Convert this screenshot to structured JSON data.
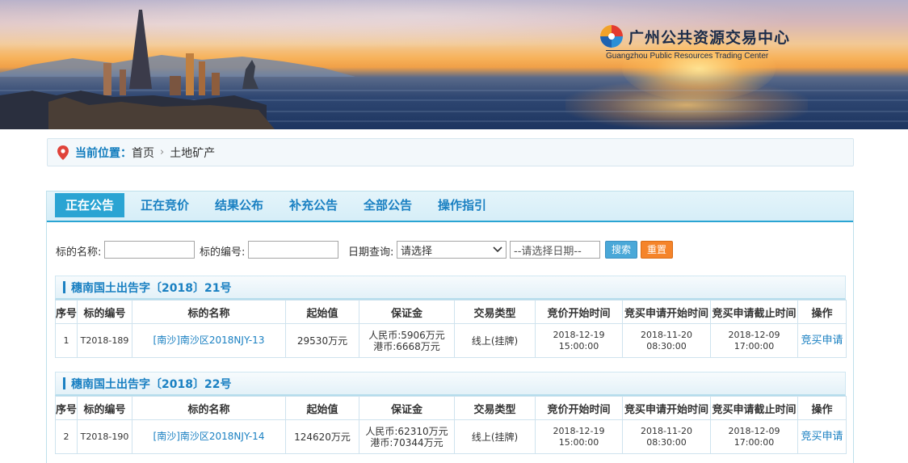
{
  "banner": {
    "logo_cn": "广州公共资源交易中心",
    "logo_en": "Guangzhou Public Resources Trading Center"
  },
  "breadcrumb": {
    "label": "当前位置：",
    "items": [
      "首页",
      "土地矿产"
    ],
    "separator": "›"
  },
  "tabs": [
    {
      "label": "正在公告",
      "active": true
    },
    {
      "label": "正在竞价",
      "active": false
    },
    {
      "label": "结果公布",
      "active": false
    },
    {
      "label": "补充公告",
      "active": false
    },
    {
      "label": "全部公告",
      "active": false
    },
    {
      "label": "操作指引",
      "active": false
    }
  ],
  "search": {
    "name_label": "标的名称:",
    "name_value": "",
    "code_label": "标的编号:",
    "code_value": "",
    "date_label": "日期查询:",
    "date_select": "请选择",
    "date_placeholder": "--请选择日期--",
    "search_btn": "搜索",
    "reset_btn": "重置"
  },
  "table_headers": [
    "序号",
    "标的编号",
    "标的名称",
    "起始值",
    "保证金",
    "交易类型",
    "竞价开始时间",
    "竞买申请开始时间",
    "竞买申请截止时间",
    "操作"
  ],
  "announcements": [
    {
      "title": "穗南国土出告字〔2018〕21号",
      "rows": [
        {
          "no": "1",
          "code": "T2018-189",
          "name": "[南沙]南沙区2018NJY-13",
          "start_value": "29530万元",
          "deposit_rmb": "人民币:5906万元",
          "deposit_hkd": "港币:6668万元",
          "type": "线上(挂牌)",
          "bid_start_date": "2018-12-19",
          "bid_start_time": "15:00:00",
          "apply_start_date": "2018-11-20",
          "apply_start_time": "08:30:00",
          "apply_end_date": "2018-12-09",
          "apply_end_time": "17:00:00",
          "action": "竞买申请"
        }
      ]
    },
    {
      "title": "穗南国土出告字〔2018〕22号",
      "rows": [
        {
          "no": "2",
          "code": "T2018-190",
          "name": "[南沙]南沙区2018NJY-14",
          "start_value": "124620万元",
          "deposit_rmb": "人民币:62310万元",
          "deposit_hkd": "港币:70344万元",
          "type": "线上(挂牌)",
          "bid_start_date": "2018-12-19",
          "bid_start_time": "15:00:00",
          "apply_start_date": "2018-11-20",
          "apply_start_time": "08:30:00",
          "apply_end_date": "2018-12-09",
          "apply_end_time": "17:00:00",
          "action": "竞买申请"
        }
      ]
    }
  ],
  "colors": {
    "accent": "#1a80c2",
    "tab_active": "#2aa4d3",
    "reset": "#f5842a",
    "search": "#4aa8d8"
  }
}
